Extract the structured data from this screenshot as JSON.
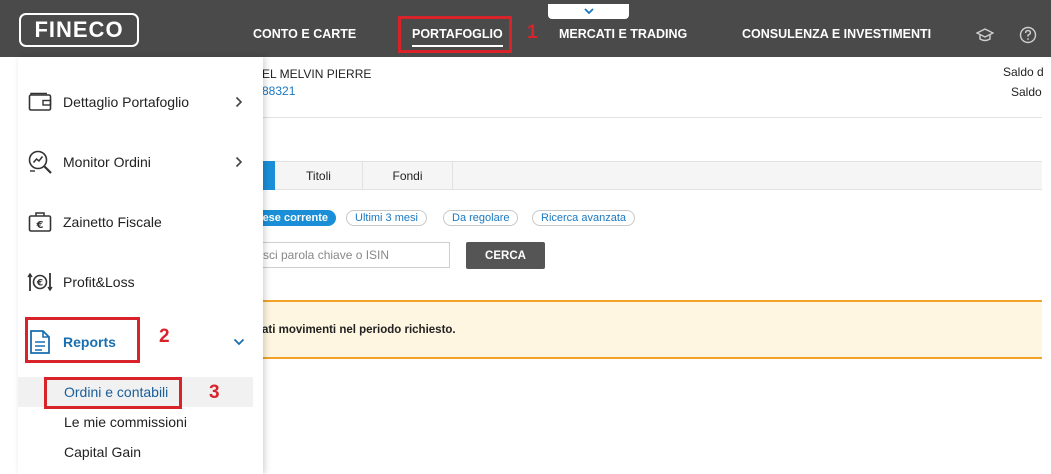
{
  "header": {
    "logo": "FINECO",
    "nav": [
      "CONTO E CARTE",
      "PORTAFOGLIO",
      "MERCATI E TRADING",
      "CONSULENZA E INVESTIMENTI"
    ]
  },
  "account": {
    "name": "EL MELVIN PIERRE",
    "number": "88321",
    "saldo1": "Saldo d",
    "saldo2": "Saldo"
  },
  "tabs": [
    "Titoli",
    "Fondi"
  ],
  "filters": {
    "active": "ese corrente",
    "options": [
      "Ultimi 3 mesi",
      "Da regolare",
      "Ricerca avanzata"
    ]
  },
  "search": {
    "placeholder": "sci parola chiave o ISIN",
    "button": "CERCA"
  },
  "alert": "ati movimenti nel periodo richiesto.",
  "sidemenu": {
    "items": [
      "Dettaglio Portafoglio",
      "Monitor Ordini",
      "Zainetto Fiscale",
      "Profit&Loss",
      "Reports"
    ],
    "subitems": [
      "Ordini e contabili",
      "Le mie commissioni",
      "Capital Gain"
    ]
  },
  "annotations": [
    "1",
    "2",
    "3"
  ],
  "colors": {
    "annotation": "#d9232b",
    "accent": "#1a8fd8",
    "topbar": "#4a4a4a",
    "alert_border": "#f2a227"
  }
}
